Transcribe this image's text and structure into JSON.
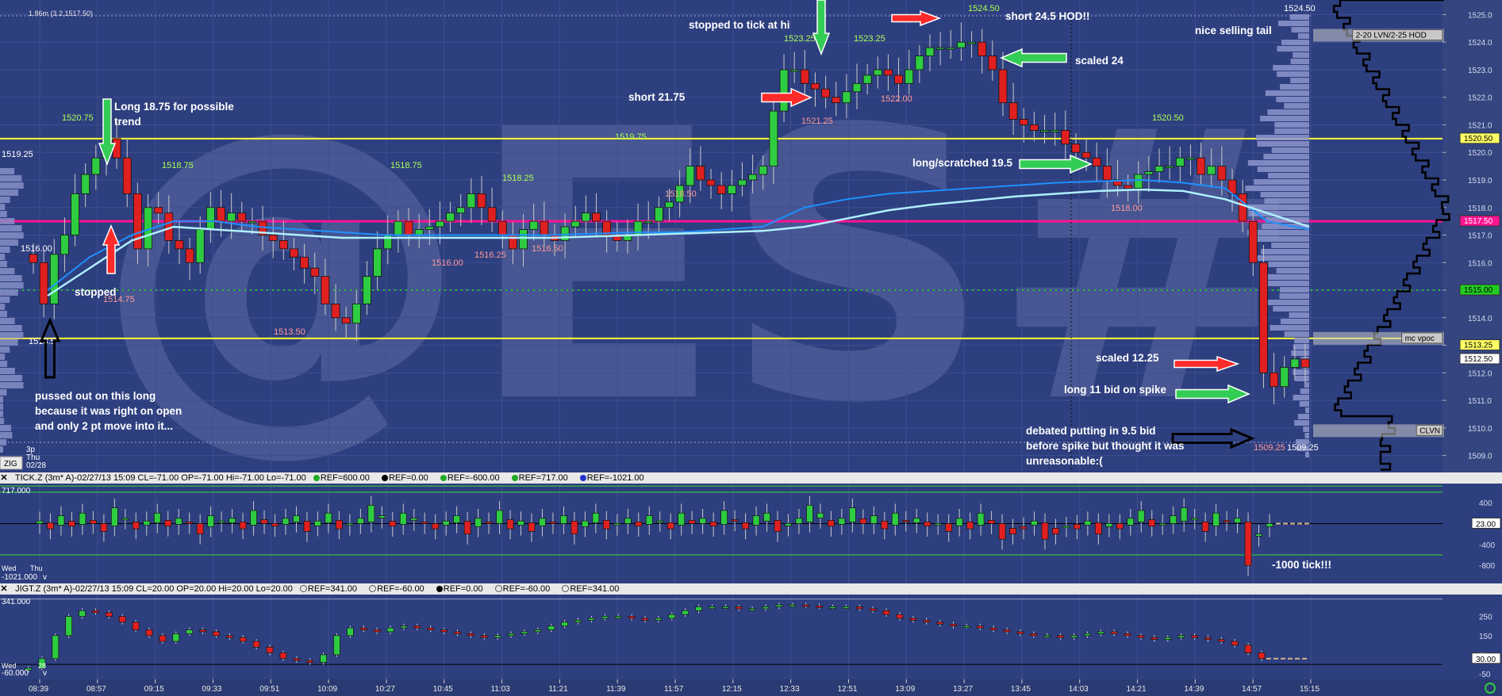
{
  "chart_data": {
    "type": "candlestick",
    "price_panel": {
      "top_readout": "1.86m (3.2,1517.50)",
      "ylim": [
        1508.5,
        1525.3
      ],
      "y_ticks": [
        1509.0,
        1510.0,
        1511.0,
        1512.0,
        1513.0,
        1514.0,
        1515.0,
        1516.0,
        1517.0,
        1518.0,
        1519.0,
        1520.0,
        1521.0,
        1522.0,
        1523.0,
        1524.0,
        1525.0
      ],
      "right_markers": [
        {
          "price": 1524.25,
          "label": "2-20 LVN/2-25 HOD",
          "bg": "#c8c8c8",
          "fg": "#000000"
        },
        {
          "price": 1520.5,
          "label": "1520.50",
          "bg": "#ffff66",
          "fg": "#000000"
        },
        {
          "price": 1517.5,
          "label": "1517.50",
          "bg": "#ff1493",
          "fg": "#ffffff"
        },
        {
          "price": 1515.0,
          "label": "1515.00",
          "bg": "#22cc22",
          "fg": "#000000"
        },
        {
          "price": 1513.25,
          "label": "mc vpoc",
          "bg": "#c8c8c8",
          "fg": "#000000"
        },
        {
          "price": 1513.0,
          "label": "1513.25",
          "bg": "#ffff66",
          "fg": "#000000"
        },
        {
          "price": 1512.5,
          "label": "1512.50",
          "bg": "#ffffff",
          "fg": "#000000"
        },
        {
          "price": 1509.9,
          "label": "CLVN",
          "bg": "#c8c8c8",
          "fg": "#000000"
        }
      ],
      "horizontal_lines": [
        {
          "price": 1520.5,
          "color": "#ffff33",
          "style": "solid"
        },
        {
          "price": 1513.25,
          "color": "#ffff33",
          "style": "solid"
        },
        {
          "price": 1517.5,
          "color": "#ff1493",
          "style": "solid"
        },
        {
          "price": 1515.0,
          "color": "#22cc22",
          "style": "dotted"
        }
      ],
      "price_labels": [
        {
          "text": "1520.75",
          "color": "#aaff55"
        },
        {
          "text": "1518.75",
          "color": "#aaff55"
        },
        {
          "text": "1518.75",
          "color": "#aaff55"
        },
        {
          "text": "1518.25",
          "color": "#aaff55"
        },
        {
          "text": "1519.75",
          "color": "#aaff55"
        },
        {
          "text": "1523.25",
          "color": "#aaff55"
        },
        {
          "text": "1523.25",
          "color": "#aaff55"
        },
        {
          "text": "1524.50",
          "color": "#aaff55"
        },
        {
          "text": "1520.50",
          "color": "#aaff55"
        },
        {
          "text": "1514.75",
          "color": "#ff9a9a"
        },
        {
          "text": "1513.50",
          "color": "#ff9a9a"
        },
        {
          "text": "1516.00",
          "color": "#ff9a9a"
        },
        {
          "text": "1516.25",
          "color": "#ff9a9a"
        },
        {
          "text": "1516.50",
          "color": "#ff9a9a"
        },
        {
          "text": "1518.50",
          "color": "#ff9a9a"
        },
        {
          "text": "1521.25",
          "color": "#ff9a9a"
        },
        {
          "text": "1522.00",
          "color": "#ff9a9a"
        },
        {
          "text": "1518.00",
          "color": "#ff9a9a"
        },
        {
          "text": "1509.25",
          "color": "#ff9a9a"
        },
        {
          "text": "1519.25",
          "color": "#ffffff"
        },
        {
          "text": "1516.00",
          "color": "#ffffff"
        },
        {
          "text": "1513.5",
          "color": "#ffffff"
        },
        {
          "text": "1524.50",
          "color": "#ffffff"
        },
        {
          "text": "1509.25",
          "color": "#ffffff"
        }
      ],
      "annotations": [
        {
          "text": "stopped to tick at hi"
        },
        {
          "text": "short 24.5 HOD!!"
        },
        {
          "text": "nice selling tail"
        },
        {
          "text": "Long 18.75 for possible"
        },
        {
          "text": "trend"
        },
        {
          "text": "scaled 24"
        },
        {
          "text": "short 21.75"
        },
        {
          "text": "long/scratched 19.5"
        },
        {
          "text": "stopped"
        },
        {
          "text": "scaled 12.25"
        },
        {
          "text": "long 11 bid on spike"
        },
        {
          "text": "pussed out on this long"
        },
        {
          "text": "because it was right on open"
        },
        {
          "text": "and only 2 pt move into it..."
        },
        {
          "text": "debated putting in 9.5 bid"
        },
        {
          "text": "before spike but thought it was"
        },
        {
          "text": "unreasonable:("
        }
      ],
      "arrows": [
        {
          "color": "#ff2a2a",
          "dir": "right"
        },
        {
          "color": "#ff2a2a",
          "dir": "right"
        },
        {
          "color": "#ff2a2a",
          "dir": "right"
        },
        {
          "color": "#ff2a2a",
          "dir": "up"
        },
        {
          "color": "#33cc55",
          "dir": "down"
        },
        {
          "color": "#33cc55",
          "dir": "down"
        },
        {
          "color": "#33cc55",
          "dir": "left"
        },
        {
          "color": "#33cc55",
          "dir": "right"
        },
        {
          "color": "#33cc55",
          "dir": "right"
        },
        {
          "color": "#000000",
          "dir": "up"
        },
        {
          "color": "#000000",
          "dir": "right"
        }
      ],
      "watermark": "@ES#",
      "date_labels": [
        "3p",
        "Thu",
        "02/28"
      ],
      "zig_label": "ZIG",
      "closes": [
        1516.0,
        1514.5,
        1516.3,
        1517.0,
        1518.5,
        1519.2,
        1519.8,
        1520.5,
        1519.8,
        1518.5,
        1516.5,
        1518.0,
        1517.8,
        1516.8,
        1516.5,
        1516.0,
        1517.2,
        1518.0,
        1517.5,
        1517.8,
        1517.5,
        1517.5,
        1517.0,
        1516.8,
        1516.5,
        1516.2,
        1515.8,
        1515.5,
        1514.5,
        1514.0,
        1513.8,
        1514.5,
        1515.5,
        1516.5,
        1517.0,
        1517.5,
        1517.0,
        1517.2,
        1517.3,
        1517.5,
        1517.8,
        1518.0,
        1518.5,
        1518.0,
        1517.5,
        1517.0,
        1516.5,
        1517.2,
        1517.5,
        1517.0,
        1516.8,
        1517.3,
        1517.5,
        1517.8,
        1517.5,
        1517.0,
        1516.8,
        1517.0,
        1517.5,
        1517.5,
        1518.0,
        1518.2,
        1518.8,
        1519.5,
        1519.0,
        1518.8,
        1518.5,
        1518.8,
        1519.0,
        1519.2,
        1519.5,
        1521.5,
        1523.0,
        1523.0,
        1522.5,
        1522.3,
        1522.0,
        1521.8,
        1522.2,
        1522.5,
        1522.8,
        1523.0,
        1522.8,
        1522.5,
        1523.0,
        1523.5,
        1523.8,
        1523.8,
        1523.8,
        1524.0,
        1524.0,
        1523.5,
        1523.0,
        1521.8,
        1521.2,
        1521.0,
        1520.8,
        1520.8,
        1520.8,
        1520.3,
        1520.0,
        1519.8,
        1519.5,
        1519.0,
        1518.8,
        1518.7,
        1519.2,
        1519.3,
        1519.5,
        1519.5,
        1519.8,
        1519.8,
        1519.2,
        1519.5,
        1519.0,
        1518.5,
        1517.5,
        1516.0,
        1512.0,
        1511.5,
        1512.2,
        1512.5,
        1512.2
      ],
      "vwap": [
        1515.0,
        1516.2,
        1517.0,
        1517.5,
        1517.5,
        1517.3,
        1517.2,
        1517.1,
        1517.0,
        1517.0,
        1517.0,
        1517.0,
        1517.0,
        1517.05,
        1517.1,
        1517.1,
        1517.2,
        1517.3,
        1518.0,
        1518.3,
        1518.5,
        1518.6,
        1518.7,
        1518.8,
        1518.9,
        1518.95,
        1519.0,
        1518.9,
        1518.7,
        1517.5,
        1517.2
      ],
      "vwap2": [
        1514.8,
        1515.8,
        1516.8,
        1517.3,
        1517.2,
        1517.1,
        1517.0,
        1516.9,
        1516.9,
        1516.9,
        1516.9,
        1516.9,
        1516.9,
        1516.95,
        1517.0,
        1517.05,
        1517.1,
        1517.15,
        1517.3,
        1517.6,
        1517.9,
        1518.1,
        1518.25,
        1518.4,
        1518.5,
        1518.6,
        1518.65,
        1518.6,
        1518.3,
        1517.8,
        1517.3
      ]
    },
    "tick_panel": {
      "header": [
        "TICK.Z (3m* A)-02/27/13 15:09 CL=-71.00 OP=-71.00 Hi=-71.00 Lo=-71.00",
        "REF=600.00",
        "REF=0.00",
        "REF=-600.00",
        "REF=717.00",
        "REF=-1021.00"
      ],
      "ref_colors": [
        "#22aa22",
        "#000000",
        "#22aa22",
        "#22aa22",
        "#2233cc"
      ],
      "left_top": "717.000",
      "left_bottom": "-1021.000",
      "left_suffix": "v",
      "date_labels": [
        "Wed",
        "Thu"
      ],
      "ylim": [
        -1100,
        750
      ],
      "y_ticks": [
        {
          "v": 400,
          "label": "400"
        },
        {
          "v": -400,
          "label": "-400"
        },
        {
          "v": -800,
          "label": "-800"
        }
      ],
      "badge": "23.00",
      "annotation": "-1000 tick!!!",
      "ref_lines": [
        {
          "v": 600,
          "color": "#33dd33"
        },
        {
          "v": 0,
          "color": "#000000"
        },
        {
          "v": -600,
          "color": "#33dd33"
        }
      ],
      "closes": [
        50,
        -100,
        150,
        -50,
        200,
        0,
        -150,
        300,
        100,
        -100,
        50,
        200,
        -50,
        100,
        0,
        -200,
        150,
        50,
        100,
        -100,
        250,
        0,
        -50,
        100,
        150,
        -150,
        50,
        200,
        -100,
        0,
        100,
        350,
        150,
        -50,
        200,
        100,
        0,
        -100,
        50,
        150,
        -200,
        100,
        0,
        250,
        -100,
        50,
        -150,
        100,
        0,
        150,
        -200,
        50,
        200,
        -100,
        0,
        100,
        -50,
        150,
        50,
        -100,
        200,
        0,
        100,
        -50,
        250,
        50,
        -100,
        150,
        200,
        -150,
        0,
        100,
        350,
        200,
        -50,
        100,
        300,
        0,
        150,
        -100,
        200,
        50,
        100,
        -50,
        0,
        -150,
        100,
        -100,
        200,
        0,
        -300,
        -200,
        -100,
        50,
        -300,
        -200,
        -50,
        -100,
        50,
        -200,
        0,
        -100,
        100,
        250,
        -50,
        0,
        150,
        300,
        100,
        -150,
        200,
        50,
        100,
        -800,
        -200,
        0
      ]
    },
    "jigt_panel": {
      "header": [
        "JIGT.Z (3m* A)-02/27/13 15:09 CL=20.00 OP=20.00 Hi=20.00 Lo=20.00",
        "REF=341.00",
        "REF=-60.00",
        "REF=0.00",
        "REF=-60.00",
        "REF=341.00"
      ],
      "ref_colors": [
        "#cccccc",
        "#cccccc",
        "#000000",
        "#cccccc",
        "#cccccc"
      ],
      "left_top": "341.000",
      "left_bottom": "-60.000",
      "left_suffix": "v",
      "date_labels": [
        "Wed",
        "28"
      ],
      "ylim": [
        -70,
        360
      ],
      "y_ticks": [
        {
          "v": 250,
          "label": "250"
        },
        {
          "v": 150,
          "label": "150"
        },
        {
          "v": 50,
          "label": "50"
        },
        {
          "v": -50,
          "label": "-50"
        }
      ],
      "badge": "30.00",
      "closes": [
        -20,
        30,
        150,
        250,
        280,
        270,
        250,
        220,
        180,
        150,
        120,
        160,
        180,
        170,
        150,
        140,
        120,
        90,
        60,
        30,
        20,
        10,
        50,
        150,
        190,
        180,
        170,
        190,
        200,
        190,
        180,
        170,
        160,
        150,
        140,
        150,
        160,
        170,
        180,
        200,
        220,
        230,
        240,
        250,
        250,
        240,
        230,
        240,
        260,
        280,
        300,
        300,
        300,
        290,
        290,
        300,
        310,
        310,
        305,
        300,
        300,
        300,
        290,
        280,
        260,
        240,
        230,
        220,
        210,
        200,
        200,
        190,
        180,
        170,
        160,
        150,
        150,
        140,
        150,
        160,
        170,
        160,
        150,
        140,
        130,
        140,
        150,
        140,
        130,
        120,
        100,
        60,
        30
      ]
    },
    "x_ticks": [
      "08:39",
      "08:57",
      "09:15",
      "09:33",
      "09:51",
      "10:09",
      "10:27",
      "10:45",
      "11:03",
      "11:21",
      "11:39",
      "11:57",
      "12:15",
      "12:33",
      "12:51",
      "13:09",
      "13:27",
      "13:45",
      "14:03",
      "14:21",
      "14:39",
      "14:57",
      "15:15"
    ]
  }
}
